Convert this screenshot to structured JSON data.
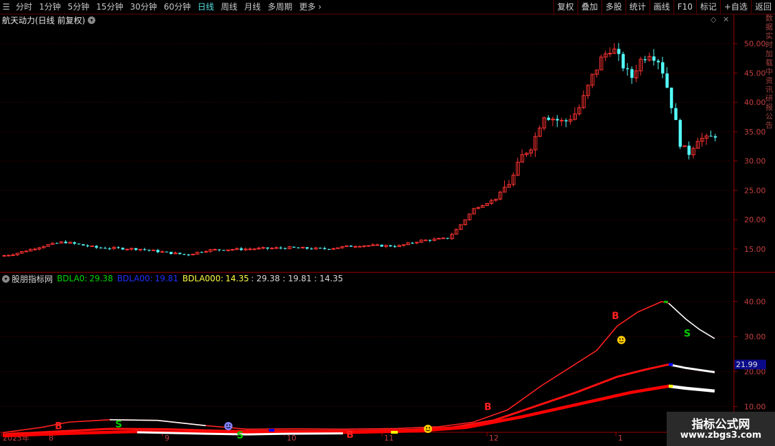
{
  "toolbar": {
    "periods": [
      "分时",
      "1分钟",
      "5分钟",
      "15分钟",
      "30分钟",
      "60分钟",
      "日线",
      "周线",
      "月线",
      "多周期",
      "更多"
    ],
    "active": "日线",
    "buttons": [
      "复权",
      "叠加",
      "多股",
      "统计",
      "画线",
      "F10",
      "标记",
      "+自选",
      "返回"
    ]
  },
  "main": {
    "title": "航天动力(日线 前复权)",
    "y_ticks": [
      "50.00",
      "45.00",
      "40.00",
      "35.00",
      "30.00",
      "25.00",
      "20.00",
      "15.00"
    ],
    "corner_icons": [
      "diamond-icon",
      "close-icon"
    ]
  },
  "indicator": {
    "name": "股朋指标网",
    "l0_label": "BDLA0:",
    "l0_value": "29.38",
    "l1_label": "BDLA00:",
    "l1_value": "19.81",
    "l2_label": "BDLA000:",
    "l2_value": "14.35",
    "extra": ": 29.38 : 19.81 : 14.35",
    "y_ticks": [
      "40.00",
      "30.00",
      "20.00",
      "10.00"
    ],
    "highlight_value": "21.99",
    "signals": {
      "b": "B",
      "s": "S"
    }
  },
  "xaxis": {
    "year_label": "2025年",
    "months": [
      "8",
      "9",
      "10",
      "11",
      "12",
      "1"
    ]
  },
  "right_strip_text": "数据实时加载中资讯研报公告",
  "watermark": {
    "line1": "指标公式网",
    "line2": "www.zbgs3.com"
  },
  "colors": {
    "up": "#ff3232",
    "down": "#54ffff",
    "grid": "#5a0000",
    "axis_text": "#c84040",
    "yellow": "#ffff00",
    "blue": "#0000ff",
    "green": "#00cc00"
  },
  "chart_data": [
    {
      "type": "candlestick",
      "title": "航天动力(日线 前复权)",
      "ylim": [
        11,
        53
      ],
      "y_ticks": [
        15,
        20,
        25,
        30,
        35,
        40,
        45,
        50
      ],
      "x_months": [
        "8",
        "9",
        "10",
        "11",
        "12",
        "1"
      ],
      "approx_close_path": [
        {
          "period": "2025-07 start",
          "close": 13.8
        },
        {
          "period": "2025-08",
          "close": 16.2
        },
        {
          "period": "2025-09",
          "close": 14.5
        },
        {
          "period": "2025-10",
          "close": 15.0
        },
        {
          "period": "2025-11",
          "close": 16.5
        },
        {
          "period": "2025-12 mid",
          "close": 24.0
        },
        {
          "period": "2025-12 end",
          "close": 38.0
        },
        {
          "period": "2026-01 peak",
          "close": 49.5
        },
        {
          "period": "latest",
          "close": 35.0
        }
      ]
    },
    {
      "type": "line",
      "title": "股朋指标网",
      "ylim": [
        3,
        45
      ],
      "y_ticks": [
        10,
        20,
        30,
        40
      ],
      "series": [
        {
          "name": "BDLA0",
          "last": 29.38,
          "approx_values": [
            1,
            6,
            4,
            3,
            3,
            8,
            25,
            40,
            29.38
          ]
        },
        {
          "name": "BDLA00",
          "last": 19.81,
          "approx_values": [
            1,
            3,
            2,
            2,
            2,
            4,
            12,
            22,
            19.81
          ]
        },
        {
          "name": "BDLA000",
          "last": 14.35,
          "approx_values": [
            0.5,
            2,
            1.5,
            1.5,
            1.5,
            3,
            8,
            15.5,
            14.35
          ]
        }
      ]
    }
  ]
}
